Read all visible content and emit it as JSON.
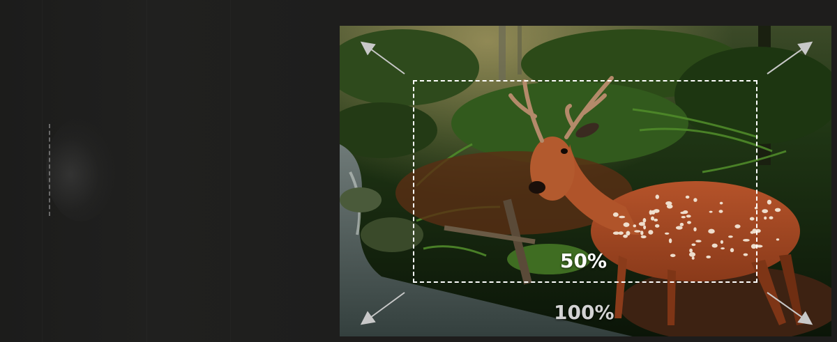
{
  "scale_labels": {
    "inner": "50%",
    "outer": "100%"
  },
  "colors": {
    "background": "#1e1d1c",
    "crop_border": "#ffffff",
    "inner_label": "#ffffff",
    "outer_label": "#d3d3d3",
    "arrow": "#c8c8c8"
  },
  "icons": [
    "expand-arrow-icon"
  ]
}
